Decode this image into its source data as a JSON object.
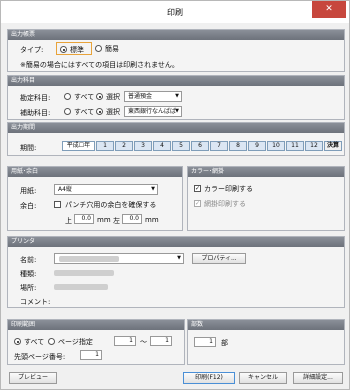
{
  "window": {
    "title": "印刷",
    "close_glyph": "✕"
  },
  "output_form": {
    "header": "出力帳票",
    "type_label": "タイプ:",
    "options": [
      "標準",
      "簡易"
    ],
    "selected": "標準",
    "note": "※簡易の場合にはすべての項目は印刷されません。"
  },
  "output_accounts": {
    "header": "出力科目",
    "rows": [
      {
        "label": "勘定科目:",
        "all_label": "すべて",
        "select_label": "選択",
        "selected_option": "選択",
        "value": "普通預金"
      },
      {
        "label": "補助科目:",
        "all_label": "すべて",
        "select_label": "選択",
        "selected_option": "選択",
        "value": "東西銀行なんばば"
      }
    ]
  },
  "output_period": {
    "header": "出力期間",
    "label": "期間:",
    "months": [
      "平成☐年",
      "1",
      "2",
      "3",
      "4",
      "5",
      "6",
      "7",
      "8",
      "9",
      "10",
      "11",
      "12",
      "決算"
    ]
  },
  "paper_margin": {
    "header": "用紙･余白",
    "paper_label": "用紙:",
    "paper_value": "A4縦",
    "margin_label": "余白:",
    "punch_label": "パンチ穴用の余白を確保する",
    "punch_checked": false,
    "top_label": "上",
    "top_value": "0.0",
    "unit1": "mm",
    "left_label": "左",
    "left_value": "0.0",
    "unit2": "mm"
  },
  "color": {
    "header": "カラー･網掛",
    "color_print_label": "カラー印刷する",
    "color_print_checked": true,
    "shade_print_label": "網掛印刷する",
    "shade_print_checked": true,
    "check_glyph": "✓"
  },
  "printer": {
    "header": "プリンタ",
    "name_label": "名前:",
    "properties_label": "プロパティ...",
    "type_label": "種類:",
    "location_label": "場所:",
    "comment_label": "コメント:"
  },
  "print_range": {
    "header": "印刷範囲",
    "all_label": "すべて",
    "page_label": "ページ指定",
    "selected": "すべて",
    "from_value": "1",
    "tilde": "～",
    "to_value": "1",
    "start_page_label": "先頭ページ番号:",
    "start_page_value": "1"
  },
  "copies": {
    "header": "部数",
    "value": "1",
    "unit": "部"
  },
  "footer": {
    "preview_label": "プレビュー",
    "print_label": "印刷(F12)",
    "cancel_label": "キャンセル",
    "detail_label": "詳細設定..."
  },
  "colors": {
    "header_bg": "#7a7f88",
    "selection_outline": "#e8a33a",
    "close_bg": "#c7473d",
    "month_button_bg": "#dbe6f3"
  },
  "icons": {
    "dropdown": "chevron-down-icon",
    "close": "close-icon",
    "check": "check-icon"
  }
}
